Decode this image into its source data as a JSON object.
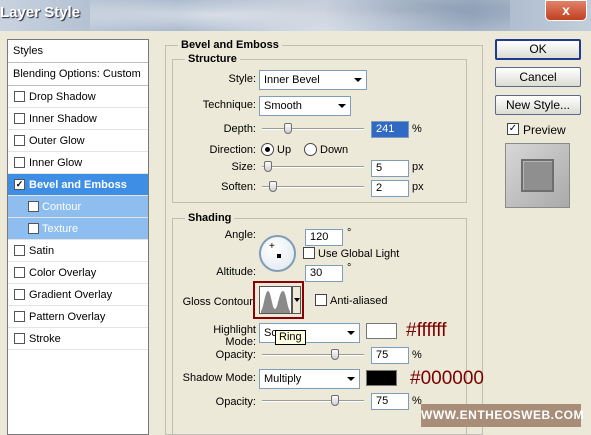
{
  "window": {
    "title": "Layer Style",
    "close_label": "x"
  },
  "styles_panel": {
    "header": "Styles",
    "blending_options": "Blending Options: Custom",
    "items": [
      {
        "label": "Drop Shadow",
        "checked": false
      },
      {
        "label": "Inner Shadow",
        "checked": false
      },
      {
        "label": "Outer Glow",
        "checked": false
      },
      {
        "label": "Inner Glow",
        "checked": false
      },
      {
        "label": "Bevel and Emboss",
        "checked": true,
        "selected": true
      },
      {
        "label": "Contour",
        "checked": false
      },
      {
        "label": "Texture",
        "checked": false
      },
      {
        "label": "Satin",
        "checked": false
      },
      {
        "label": "Color Overlay",
        "checked": false
      },
      {
        "label": "Gradient Overlay",
        "checked": false
      },
      {
        "label": "Pattern Overlay",
        "checked": false
      },
      {
        "label": "Stroke",
        "checked": false
      }
    ],
    "check_mark": "✓"
  },
  "buttons": {
    "ok": "OK",
    "cancel": "Cancel",
    "new_style": "New Style..."
  },
  "preview": {
    "label": "Preview",
    "checked": true
  },
  "bevel": {
    "title": "Bevel and Emboss",
    "structure": {
      "title": "Structure",
      "style_label": "Style:",
      "style_value": "Inner Bevel",
      "technique_label": "Technique:",
      "technique_value": "Smooth",
      "depth_label": "Depth:",
      "depth_value": "241",
      "depth_unit": "%",
      "depth_level": 0.24,
      "direction_label": "Direction:",
      "dir_up": "Up",
      "dir_down": "Down",
      "direction_selected": "Up",
      "size_label": "Size:",
      "size_value": "5",
      "size_unit": "px",
      "size_level": 0.02,
      "soften_label": "Soften:",
      "soften_value": "2",
      "soften_unit": "px",
      "soften_level": 0.08
    },
    "shading": {
      "title": "Shading",
      "angle_label": "Angle:",
      "angle_value": "120",
      "degree": "°",
      "use_global_light": "Use Global Light",
      "use_global_light_checked": false,
      "altitude_label": "Altitude:",
      "altitude_value": "30",
      "gloss_contour_label": "Gloss Contour:",
      "anti_aliased": "Anti-aliased",
      "anti_aliased_checked": false,
      "tooltip": "Ring",
      "highlight_mode_label": "Highlight Mode:",
      "highlight_mode_value": "Sc",
      "highlight_color": "#ffffff",
      "highlight_opacity_label": "Opacity:",
      "highlight_opacity": "75",
      "opacity_unit": "%",
      "highlight_opacity_level": 0.75,
      "shadow_mode_label": "Shadow Mode:",
      "shadow_mode_value": "Multiply",
      "shadow_color": "#000000",
      "shadow_opacity_label": "Opacity:",
      "shadow_opacity": "75",
      "shadow_opacity_level": 0.75
    }
  },
  "annotations": {
    "highlight_hex": "#ffffff",
    "shadow_hex": "#000000",
    "contour_highlight_color": "#8b0000"
  },
  "watermark": "WWW.ENTHEOSWEB.COM"
}
